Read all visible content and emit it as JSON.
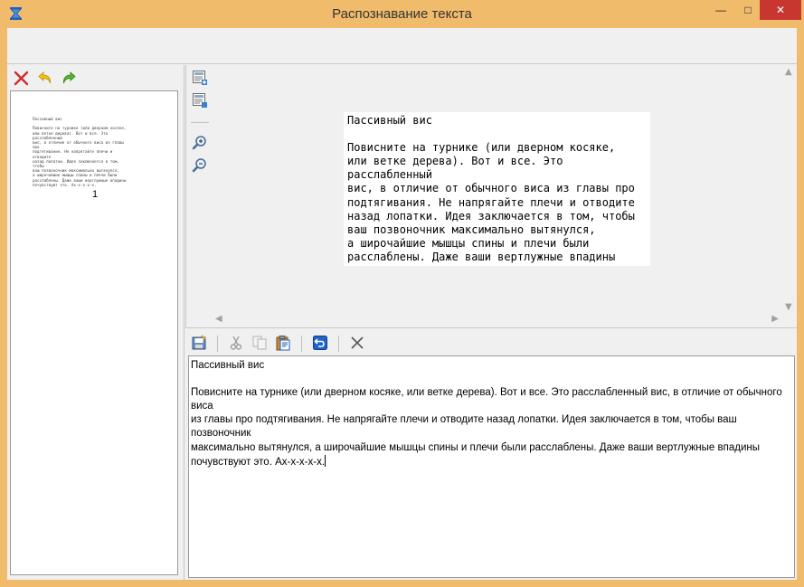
{
  "window": {
    "title": "Распознавание текста",
    "min_glyph": "—",
    "max_glyph": "□",
    "close_glyph": "✕"
  },
  "icons": {
    "app": "scanner-icon",
    "left_toolbar": [
      "delete-icon",
      "undo-icon",
      "redo-icon"
    ],
    "view_toolbar": [
      "add-page-icon",
      "page-properties-icon",
      "zoom-in-icon",
      "zoom-out-icon"
    ],
    "edit_toolbar": [
      "save-icon",
      "cut-icon",
      "copy-icon",
      "paste-icon",
      "undo-icon",
      "clear-icon"
    ]
  },
  "colors": {
    "title_bar": "#f0bc6c",
    "close_button": "#c7372f",
    "delete_icon": "#d12b2b",
    "undo_icon": "#e8b800",
    "redo_icon": "#3aa21a",
    "tool_blue": "#1f5fb8"
  },
  "thumbnail": {
    "page_number": "1",
    "text": "Пассивный вис\n\nПовисните на турнике (или дверном косяке,\nили ветке дерева). Вот и все. Это расслабленный\nвис, в отличие от обычного виса из главы про\nподтягивания. Не напрягайте плечи и отводите\nназад лопатки. Идея заключается в том, чтобы\nваш позвоночник максимально вытянулся,\nа широчайшие мышцы спины и плечи были\nрасслаблены. Даже ваши вертлужные впадины\nпочувствуют это. Ах-х-х-х-х."
  },
  "scan": {
    "text": "Пассивный вис\n\nПовисните на турнике (или дверном косяке,\nили ветке дерева). Вот и все. Это расслабленный\nвис, в отличие от обычного виса из главы про\nподтягивания. Не напрягайте плечи и отводите\nназад лопатки. Идея заключается в том, чтобы\nваш позвоночник максимально вытянулся,\nа широчайшие мышцы спины и плечи были\nрасслаблены. Даже ваши вертлужные впадины\nпочувствуют это. Ах-х-х-х-х."
  },
  "editor": {
    "text": "Пассивный вис\n\nПовисните на турнике (или дверном косяке, или ветке дерева). Вот и все. Это расслабленный вис, в отличие от обычного виса\nиз главы про подтягивания. Не напрягайте плечи и отводите назад лопатки. Идея заключается в том, чтобы ваш позвоночник\nмаксимально вытянулся, а широчайшие мышцы спины и плечи были расслаблены. Даже ваши вертлужные впадины\nпочувствуют это. Ах-х-х-х-х."
  }
}
